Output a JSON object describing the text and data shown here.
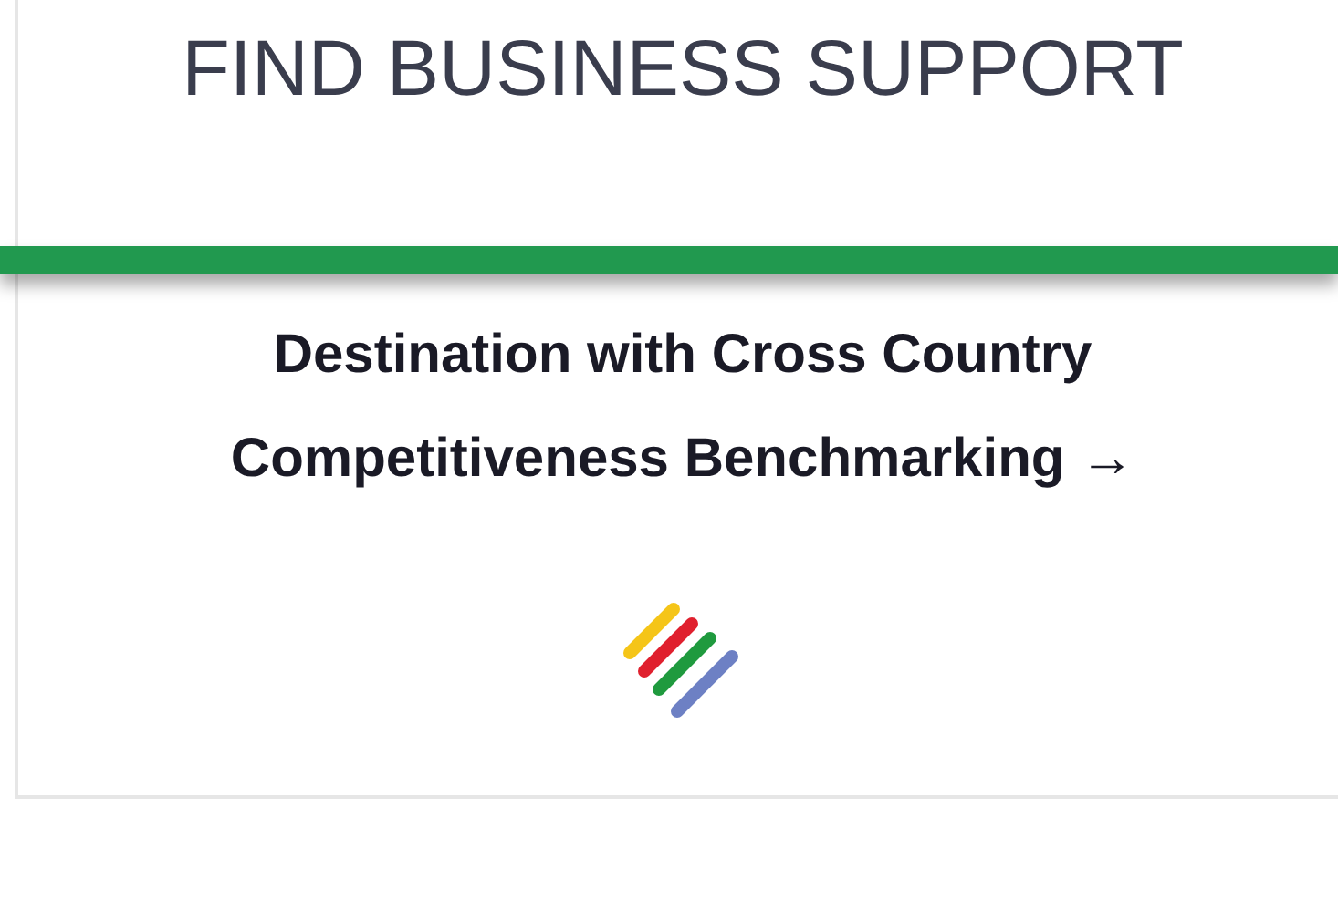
{
  "card": {
    "heading": "FIND BUSINESS SUPPORT",
    "link": "Destination with Cross Country Competitiveness Benchmarking →"
  }
}
